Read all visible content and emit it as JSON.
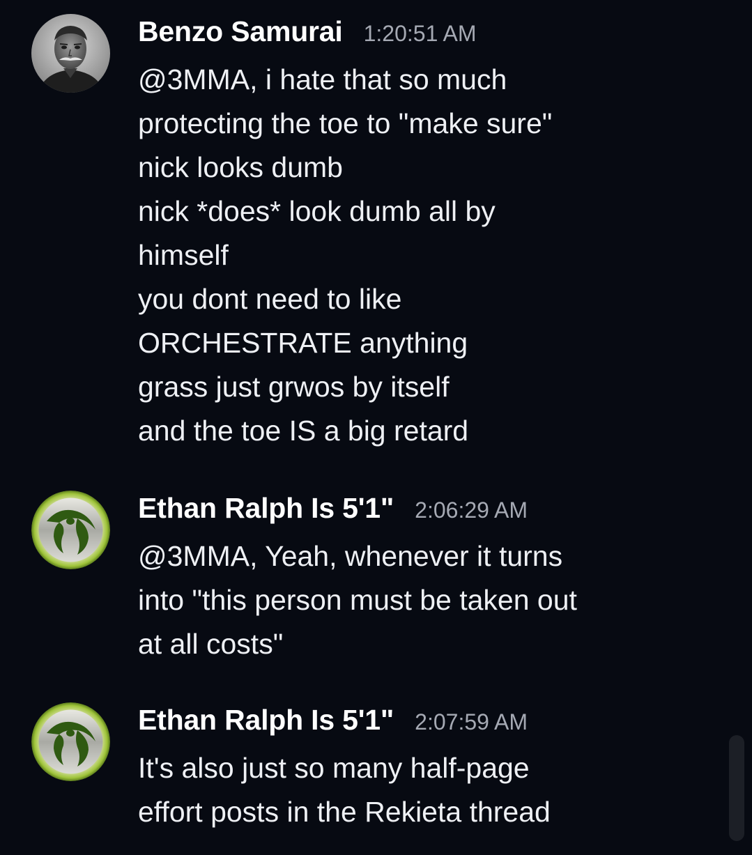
{
  "messages": [
    {
      "author": "Benzo Samurai",
      "time": "1:20:51 AM",
      "avatar": "portrait-photo",
      "lines": [
        "@3MMA, i hate that so much",
        "protecting the toe to \"make sure\"",
        "nick looks dumb",
        "nick *does* look dumb all by",
        "himself",
        "you dont need to like",
        "ORCHESTRATE anything",
        "grass just grwos by itself",
        "and the toe IS a big retard"
      ]
    },
    {
      "author": "Ethan Ralph Is 5'1\"",
      "time": "2:06:29 AM",
      "avatar": "green-emblem-logo",
      "lines": [
        "@3MMA, Yeah, whenever it turns",
        "into \"this person must be taken out",
        "at all costs\""
      ]
    },
    {
      "author": "Ethan Ralph Is 5'1\"",
      "time": "2:07:59 AM",
      "avatar": "green-emblem-logo",
      "lines": [
        "It's also just so many half-page",
        "effort posts in the Rekieta thread"
      ]
    }
  ],
  "colors": {
    "background": "#070a12",
    "author": "#ffffff",
    "timestamp": "#a5a9b3",
    "text": "#eef0f4",
    "emblem_green": "#2f5a12",
    "emblem_ring": "#9fc43a"
  }
}
